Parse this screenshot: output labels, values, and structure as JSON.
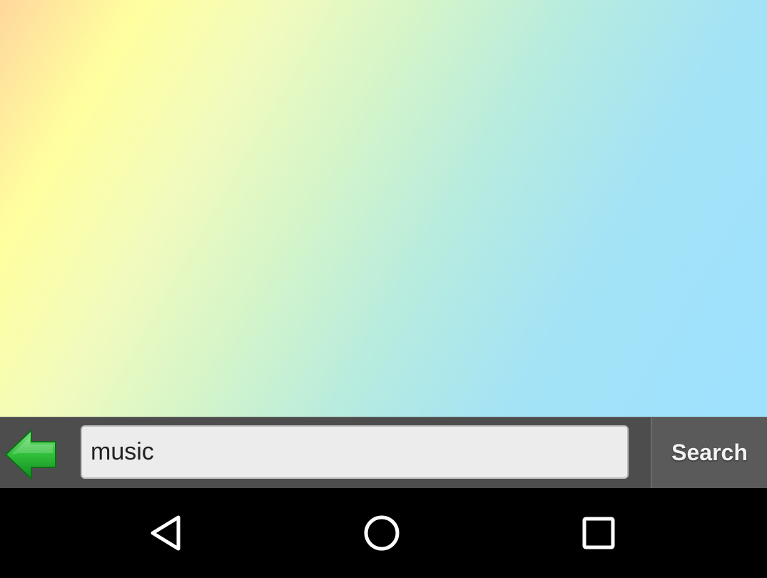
{
  "search": {
    "value": "music",
    "button_label": "Search"
  },
  "icons": {
    "back": "green-back-arrow-icon",
    "nav_back": "triangle-back-icon",
    "nav_home": "circle-home-icon",
    "nav_recents": "square-recents-icon"
  },
  "colors": {
    "toolbar_bg": "#4d4d4d",
    "arrow_green": "#2fbf3a",
    "nav_bg": "#000000"
  }
}
